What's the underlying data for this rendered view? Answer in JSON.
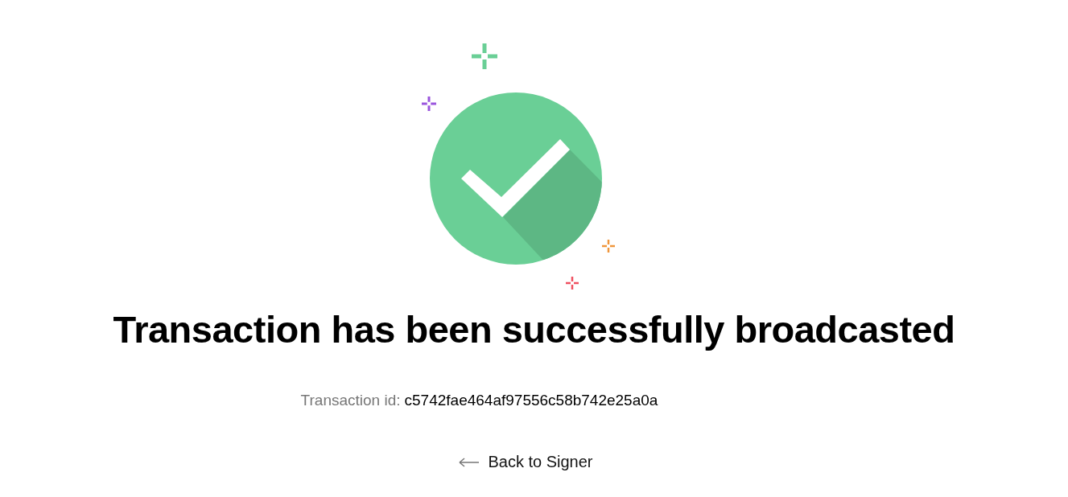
{
  "heading": "Transaction has been successfully broadcasted",
  "transaction": {
    "label": "Transaction id:",
    "value": "c5742fae464af97556c58b742e25a0a"
  },
  "back_link": {
    "label": "Back to Signer"
  }
}
